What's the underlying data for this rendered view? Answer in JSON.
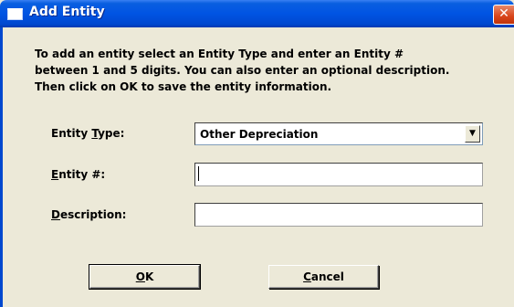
{
  "window": {
    "title": "Add Entity",
    "close_glyph": "✕"
  },
  "instructions": "To add an entity select an Entity Type and enter an Entity # between 1 and 5 digits. You can also enter an optional description. Then click on OK to save the entity information.",
  "form": {
    "entity_type": {
      "label_mnemonic_prefix": "Entity ",
      "label_mnemonic_char": "T",
      "label_mnemonic_suffix": "ype:",
      "selected_value": "Other Depreciation"
    },
    "entity_number": {
      "label_mnemonic_char": "E",
      "label_mnemonic_suffix": "ntity #:",
      "value": ""
    },
    "description": {
      "label_mnemonic_char": "D",
      "label_mnemonic_suffix": "escription:",
      "value": ""
    }
  },
  "buttons": {
    "ok_mnemonic_char": "O",
    "ok_suffix": "K",
    "cancel_mnemonic_char": "C",
    "cancel_suffix": "ancel"
  },
  "icons": {
    "window_icon": "window-icon",
    "dropdown_arrow": "▼"
  }
}
